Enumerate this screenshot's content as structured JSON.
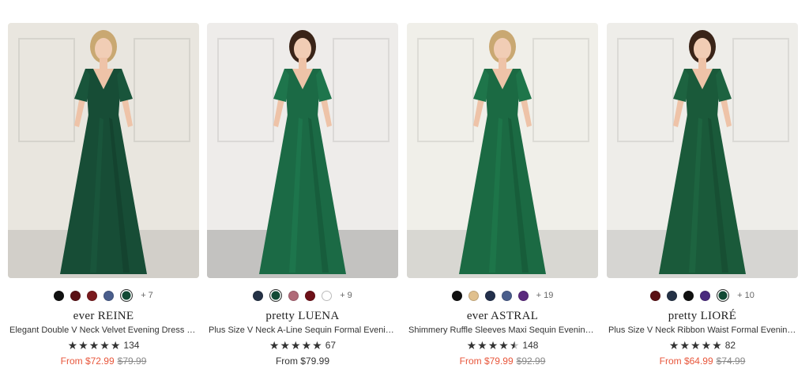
{
  "products": [
    {
      "brand": "ever REINE",
      "name": "Elegant Double V Neck Velvet Evening Dress wit...",
      "rating_stars": 5,
      "review_count": "134",
      "price_prefix": "From $72.99",
      "original_price": "$79.99",
      "on_sale": true,
      "swatches": [
        "#111111",
        "#5a1014",
        "#7a1a1e",
        "#4a5e8c",
        "#124a35"
      ],
      "selected_swatch": 4,
      "more_colors": "+ 7",
      "dress_color": "#174d36",
      "bg_color": "#e9e6df"
    },
    {
      "brand": "pretty LUENA",
      "name": "Plus Size V Neck A-Line Sequin Formal Evening...",
      "rating_stars": 5,
      "review_count": "67",
      "price_prefix": "From $79.99",
      "original_price": "",
      "on_sale": false,
      "swatches": [
        "#253246",
        "#124a35",
        "#b06a78",
        "#6e1018",
        "#ffffff"
      ],
      "selected_swatch": 1,
      "more_colors": "+ 9",
      "dress_color": "#1b6a45",
      "bg_color": "#eeecea"
    },
    {
      "brand": "ever ASTRAL",
      "name": "Shimmery Ruffle Sleeves Maxi Sequin Evening...",
      "rating_stars": 4.5,
      "review_count": "148",
      "price_prefix": "From $79.99",
      "original_price": "$92.99",
      "on_sale": true,
      "swatches": [
        "#111111",
        "#e0c08e",
        "#23304c",
        "#4a5e8c",
        "#5b2a7e"
      ],
      "selected_swatch": -1,
      "more_colors": "+ 19",
      "dress_color": "#1b6a43",
      "bg_color": "#f0efe9"
    },
    {
      "brand": "pretty LIORÉ",
      "name": "Plus Size V Neck Ribbon Waist Formal Evening...",
      "rating_stars": 5,
      "review_count": "82",
      "price_prefix": "From $64.99",
      "original_price": "$74.99",
      "on_sale": true,
      "swatches": [
        "#5a1014",
        "#253246",
        "#111111",
        "#4a2a7e",
        "#124a35"
      ],
      "selected_swatch": 4,
      "more_colors": "+ 10",
      "dress_color": "#1a5a3a",
      "bg_color": "#eeede9"
    }
  ],
  "colors": {
    "sale_price": "#e8573c",
    "original_price": "#888888",
    "star": "#333333"
  }
}
